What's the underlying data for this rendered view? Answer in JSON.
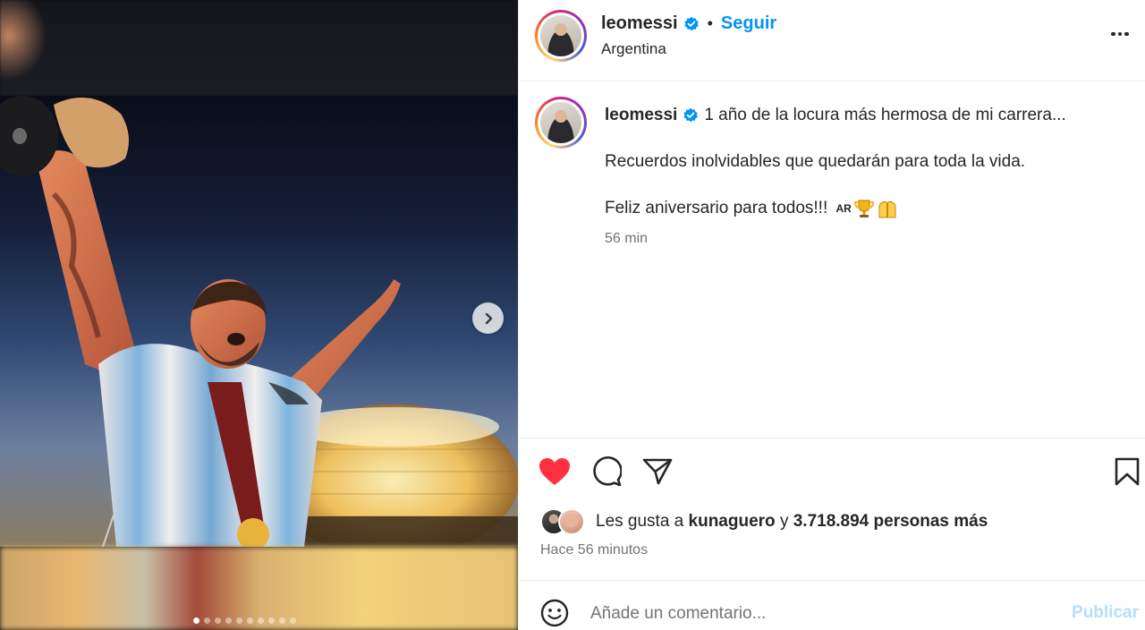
{
  "post": {
    "username": "leomessi",
    "follow_label": "Seguir",
    "location": "Argentina",
    "caption_first": "1 año de la locura más hermosa de mi carrera...",
    "caption_second": "Recuerdos inolvidables que quedarán para toda la vida.",
    "caption_third": "Feliz aniversario para todos!!!",
    "flag_text": "AR",
    "caption_emojis": [
      "trophy-icon",
      "raised-hands-icon"
    ],
    "caption_time": "56 min"
  },
  "carousel": {
    "total_slides": 10,
    "active_slide": 1,
    "next_icon": "chevron-right-icon"
  },
  "actions": {
    "liked": true,
    "icons": [
      "heart-icon",
      "comment-icon",
      "share-icon",
      "bookmark-icon"
    ],
    "like_color": "#ff3040"
  },
  "likes": {
    "prefix": "Les gusta a",
    "liker": "kunaguero",
    "connector": "y",
    "others": "3.718.894 personas más"
  },
  "posted_ago": "Hace 56 minutos",
  "comment": {
    "placeholder": "Añade un comentario...",
    "publish_label": "Publicar"
  },
  "colors": {
    "accent": "#0095f6",
    "verified": "#0095f6",
    "muted": "#737373"
  }
}
